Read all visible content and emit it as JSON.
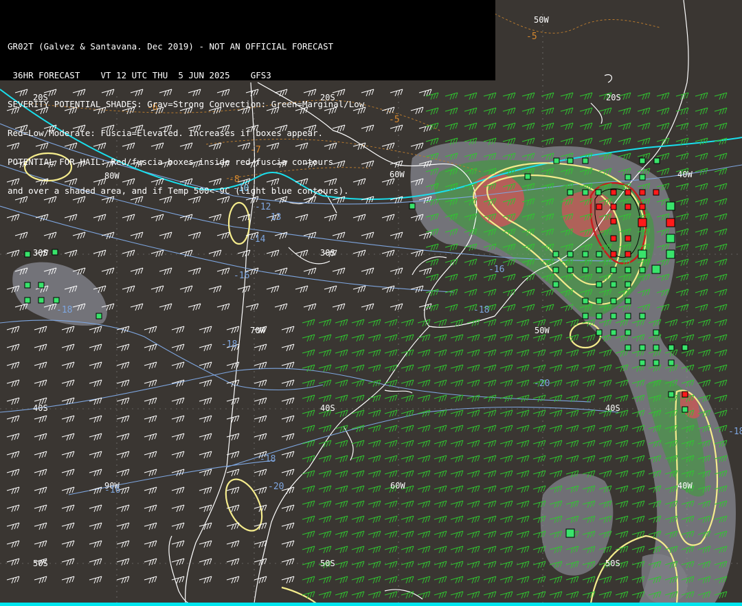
{
  "header": {
    "line1": "GR02T (Galvez & Santavana. Dec 2019) - NOT AN OFFICIAL FORECAST",
    "line2": " 36HR FORECAST    VT 12 UTC THU  5 JUN 2025    GFS3",
    "line3": "SEVERITY POTENTIAL SHADES: Grav=Strong Convection: Green=Marginal/Low",
    "line4": "Red=Low/Moderate: Fuscia=Elevated. Increases if boxes appear.",
    "line5": "POTENTIAL FOR HAIL: Red/fuscia boxes inside red/fuscia contours",
    "line6": "and over a shaded area, and if Temp 500<-9C (light blue contours)."
  },
  "grid_labels": {
    "lon_50w_top": "50W",
    "lat_20s_left": "20S",
    "lat_20s_mid": "20S",
    "lat_20s_right": "20S",
    "lon_80w": "80W",
    "lon_60w": "60W",
    "lon_40w": "40W",
    "lat_30s_left": "30S",
    "lat_30s_mid": "30S",
    "lon_70w": "70W",
    "lon_50w_mid": "50W",
    "lat_40s_left": "40S",
    "lat_40s_mid": "40S",
    "lat_40s_right": "40S",
    "lon_90w": "90W",
    "lon_60w_low": "60W",
    "lon_40w_low": "40W",
    "lat_50s_left": "50S",
    "lat_50s_mid": "50S",
    "lat_50s_right": "50S"
  },
  "temp_labels": {
    "t_m5_top": "-5",
    "t_m6": "-6",
    "t_m5_mid": "-5",
    "t_m7": "-7",
    "t_m8": "-8",
    "t_m10": "-10",
    "t_m12": "-12",
    "t_m13": "-13",
    "t_m14": "-14",
    "t_m16_left": "-16",
    "t_m16_right": "-16",
    "t_m18_a": "-18",
    "t_m18_b": "-18",
    "t_m18_c": "-18",
    "t_m20_a": "-20",
    "t_m20_b": "-20",
    "t_m18_d": "-18",
    "t_m16_low": "-16",
    "t_m18_e": "-18"
  },
  "colors": {
    "background": "#3a3632",
    "land_outline": "#ffffff",
    "shade_strong": "#7e7e86",
    "shade_marginal": "#4f8f4f",
    "shade_moderate": "#c05a5a",
    "hail_contour": "#c81e1e",
    "yellow_contour": "#f5ec8c",
    "temp_contour": "#7ea6e0",
    "cyan_line": "#19e0ee",
    "orange_dashed": "#b87a2e",
    "wind_green": "#30c630",
    "wind_white": "#ffffff",
    "box_green": "#39e36b",
    "box_red": "#ff1a1a"
  }
}
